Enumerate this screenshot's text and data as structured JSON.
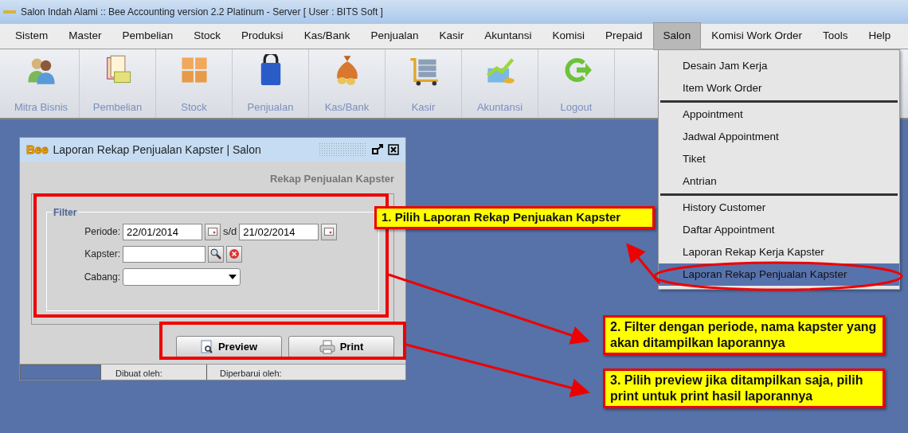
{
  "window": {
    "title": "Salon Indah Alami :: Bee Accounting version 2.2 Platinum - Server  [ User : BITS Soft ]"
  },
  "menu": [
    {
      "label": "Sistem",
      "selected": false
    },
    {
      "label": "Master",
      "selected": false
    },
    {
      "label": "Pembelian",
      "selected": false
    },
    {
      "label": "Stock",
      "selected": false
    },
    {
      "label": "Produksi",
      "selected": false
    },
    {
      "label": "Kas/Bank",
      "selected": false
    },
    {
      "label": "Penjualan",
      "selected": false
    },
    {
      "label": "Kasir",
      "selected": false
    },
    {
      "label": "Akuntansi",
      "selected": false
    },
    {
      "label": "Komisi",
      "selected": false
    },
    {
      "label": "Prepaid",
      "selected": false
    },
    {
      "label": "Salon",
      "selected": true
    },
    {
      "label": "Komisi Work Order",
      "selected": false
    },
    {
      "label": "Tools",
      "selected": false
    },
    {
      "label": "Help",
      "selected": false
    }
  ],
  "toolbar": [
    {
      "label": "Mitra Bisnis"
    },
    {
      "label": "Pembelian"
    },
    {
      "label": "Stock"
    },
    {
      "label": "Penjualan"
    },
    {
      "label": "Kas/Bank"
    },
    {
      "label": "Kasir"
    },
    {
      "label": "Akuntansi"
    },
    {
      "label": "Logout"
    }
  ],
  "dropdown": {
    "groups": [
      {
        "items": [
          {
            "label": "Desain Jam Kerja",
            "selected": false
          },
          {
            "label": "Item Work Order",
            "selected": false
          }
        ]
      },
      {
        "items": [
          {
            "label": "Appointment",
            "selected": false
          },
          {
            "label": "Jadwal Appointment",
            "selected": false
          },
          {
            "label": "Tiket",
            "selected": false
          },
          {
            "label": "Antrian",
            "selected": false
          }
        ]
      },
      {
        "items": [
          {
            "label": "History Customer",
            "selected": false
          },
          {
            "label": "Daftar Appointment",
            "selected": false
          },
          {
            "label": "Laporan Rekap Kerja Kapster",
            "selected": false
          },
          {
            "label": "Laporan Rekap Penjualan Kapster",
            "selected": true
          }
        ]
      }
    ]
  },
  "report_window": {
    "logo": "Bee",
    "title": "Laporan Rekap Penjualan Kapster | Salon",
    "heading": "Rekap Penjualan Kapster",
    "filter": {
      "legend": "Filter",
      "periode_label": "Periode:",
      "date_from": "22/01/2014",
      "range_sep": "s/d",
      "date_to": "21/02/2014",
      "kapster_label": "Kapster:",
      "cabang_label": "Cabang:"
    },
    "buttons": [
      {
        "label": "Preview",
        "kind": "preview"
      },
      {
        "label": "Print",
        "kind": "print"
      }
    ],
    "status_bar": {
      "created": "Dibuat oleh:",
      "updated": "Diperbarui oleh:"
    }
  },
  "callouts": [
    {
      "text": "1. Pilih Laporan Rekap Penjuakan Kapster"
    },
    {
      "text": "2. Filter dengan periode, nama kapster yang akan ditampilkan laporannya"
    },
    {
      "text": "3. Pilih preview jika ditampilkan saja, pilih print untuk print hasil laporannya"
    }
  ]
}
